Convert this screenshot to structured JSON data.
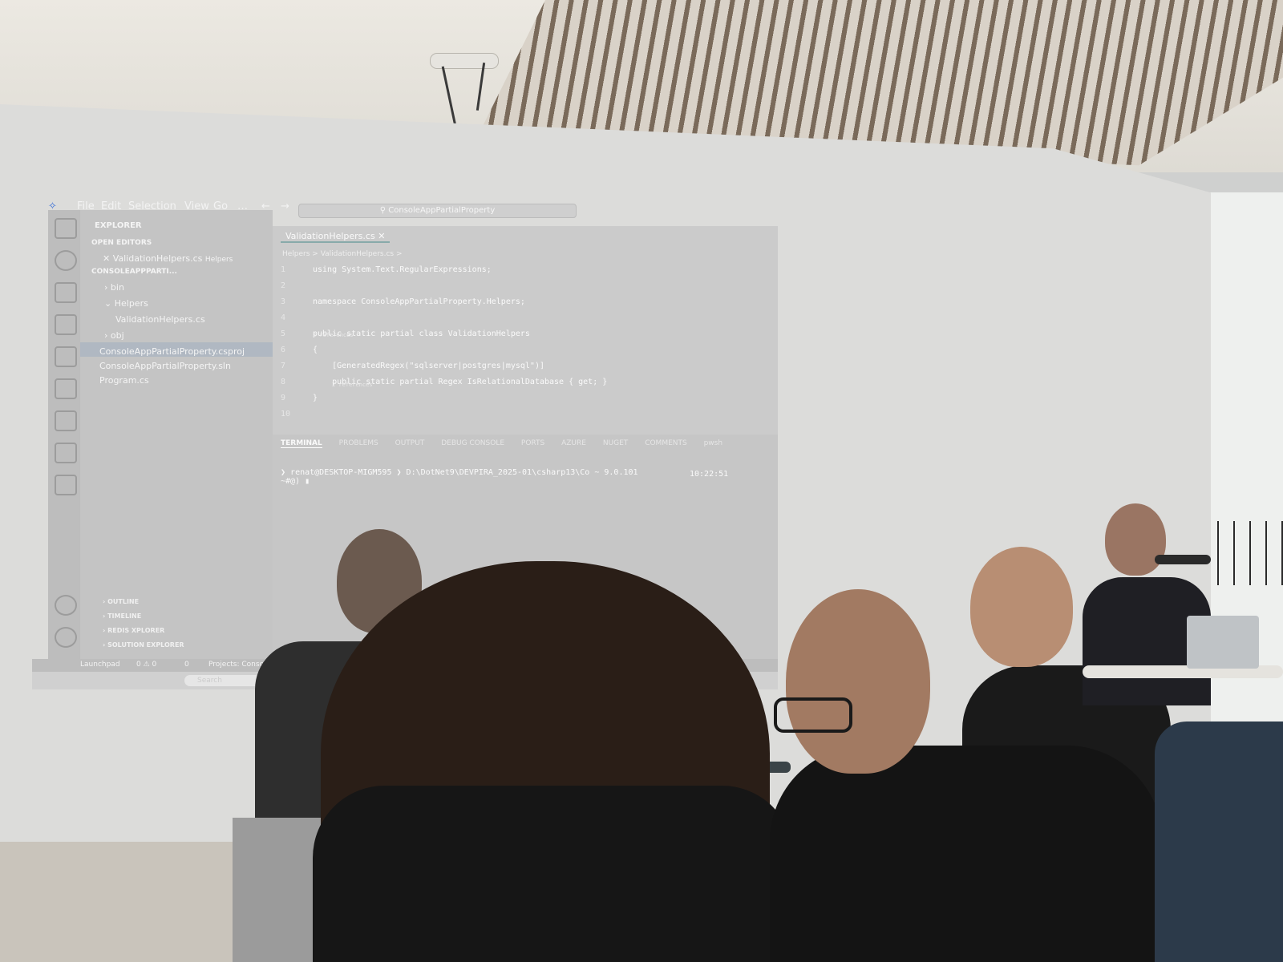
{
  "menu": {
    "items": [
      "File",
      "Edit",
      "Selection",
      "View",
      "Go",
      "…"
    ]
  },
  "titlebar": {
    "search": "ConsoleAppPartialProperty"
  },
  "explorer": {
    "title": "EXPLORER",
    "open_editors_label": "OPEN EDITORS",
    "open_editor_file": "ValidationHelpers.cs",
    "open_editor_folder": "Helpers",
    "project_label": "CONSOLEAPPPARTI...",
    "tree": [
      "bin",
      "Helpers",
      "ValidationHelpers.cs",
      "obj",
      "ConsoleAppPartialProperty.csproj",
      "ConsoleAppPartialProperty.sln",
      "Program.cs"
    ],
    "sections": [
      "OUTLINE",
      "TIMELINE",
      "REDIS XPLORER",
      "SOLUTION EXPLORER"
    ]
  },
  "editor": {
    "tab": "ValidationHelpers.cs",
    "breadcrumb": "Helpers > ValidationHelpers.cs >",
    "lines": [
      {
        "n": "1",
        "text": "using System.Text.RegularExpressions;"
      },
      {
        "n": "2",
        "text": ""
      },
      {
        "n": "3",
        "text": "namespace ConsoleAppPartialProperty.Helpers;"
      },
      {
        "n": "4",
        "text": ""
      },
      {
        "n": "5",
        "text": "public static partial class ValidationHelpers"
      },
      {
        "n": "6",
        "text": "{"
      },
      {
        "n": "7",
        "text": "    [GeneratedRegex(\"sqlserver|postgres|mysql\")]"
      },
      {
        "n": "8",
        "text": "    public static partial Regex IsRelationalDatabase { get; }"
      },
      {
        "n": "9",
        "text": "}"
      },
      {
        "n": "10",
        "text": ""
      }
    ],
    "codelens_class": "2 references",
    "codelens_prop": "2 references"
  },
  "panel": {
    "tabs": [
      "TERMINAL",
      "PROBLEMS",
      "OUTPUT",
      "DEBUG CONSOLE",
      "PORTS",
      "AZURE",
      "NUGET",
      "COMMENTS"
    ],
    "shell": "pwsh",
    "prompt_user": "renat@DESKTOP-MIGM595",
    "prompt_path": "D:\\DotNet9\\DEVPIRA_2025-01\\csharp13\\Co",
    "version": "9.0.101",
    "time": "10:22:51",
    "prompt_tail": "~#@)"
  },
  "statusbar": {
    "items": [
      "Launchpad",
      "0 ⚠ 0",
      "0",
      "Projects: Console..."
    ]
  },
  "taskbar": {
    "search": "Search"
  },
  "colors": {
    "screen": "#dcdcda",
    "editor_bg": "#cbcbcb",
    "sidebar_bg": "#c4c4c4",
    "shirt": "#1c1c1c"
  }
}
